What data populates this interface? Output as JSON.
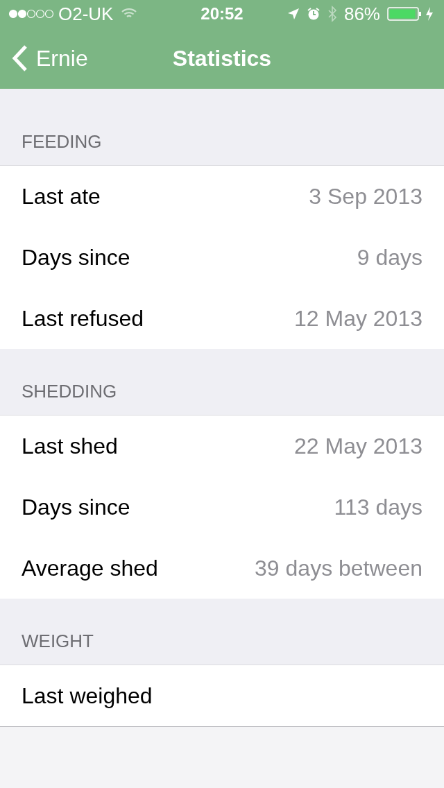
{
  "status_bar": {
    "carrier": "O2-UK",
    "time": "20:52",
    "battery": "86%"
  },
  "nav": {
    "back": "Ernie",
    "title": "Statistics"
  },
  "sections": [
    {
      "header": "FEEDING",
      "rows": [
        {
          "label": "Last ate",
          "value": "3 Sep 2013"
        },
        {
          "label": "Days since",
          "value": "9 days"
        },
        {
          "label": "Last refused",
          "value": "12 May 2013"
        }
      ]
    },
    {
      "header": "SHEDDING",
      "rows": [
        {
          "label": "Last shed",
          "value": "22 May 2013"
        },
        {
          "label": "Days since",
          "value": "113 days"
        },
        {
          "label": "Average shed",
          "value": "39 days between"
        }
      ]
    },
    {
      "header": "WEIGHT",
      "rows": [
        {
          "label": "Last weighed"
        }
      ]
    }
  ]
}
